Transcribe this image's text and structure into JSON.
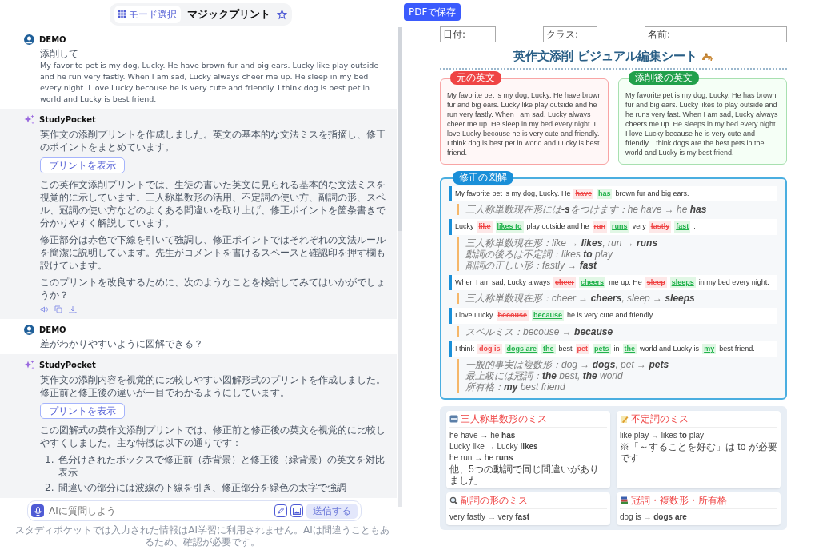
{
  "header": {
    "mode_button": "モード選択",
    "title": "マジックプリント",
    "favorited": false
  },
  "messages": [
    {
      "kind": "user",
      "author": "DEMO",
      "lines": [
        "添削して",
        "My favorite pet is my dog, Lucky. He have brown fur and big ears. Lucky like play outside and he run very fastly. When I am sad, Lucky always cheer me up. He sleep in my bed every night. I love Lucky becouse he is very cute and friendly. I think dog is best pet in world and Lucky is best friend."
      ]
    },
    {
      "kind": "bot",
      "author": "StudyPocket",
      "blocks": [
        {
          "kind": "text",
          "text": "英作文の添削プリントを作成しました。英文の基本的な文法ミスを指摘し、修正のポイントをまとめています。"
        },
        {
          "kind": "button",
          "text": "プリントを表示"
        },
        {
          "kind": "text",
          "text": "この英作文添削プリントでは、生徒の書いた英文に見られる基本的な文法ミスを視覚的に示しています。三人称単数形の活用、不定詞の使い方、副詞の形、スペル、冠詞の使い方などのよくある間違いを取り上げ、修正ポイントを箇条書きで分かりやすく解説しています。"
        },
        {
          "kind": "text",
          "text": "修正部分は赤色で下線を引いて強調し、修正ポイントではそれぞれの文法ルールを簡潔に説明しています。先生がコメントを書けるスペースと確認印を押す欄も設けています。"
        },
        {
          "kind": "text",
          "text": "このプリントを改良するために、次のようなことを検討してみてはいかがでしょうか？"
        },
        {
          "kind": "actions"
        }
      ]
    },
    {
      "kind": "user",
      "author": "DEMO",
      "lines": [
        "差がわかりやすいように図解できる？"
      ]
    },
    {
      "kind": "bot",
      "author": "StudyPocket",
      "blocks": [
        {
          "kind": "text",
          "text": "英作文の添削内容を視覚的に比較しやすい図解形式のプリントを作成しました。修正前と修正後の違いが一目でわかるようにしています。"
        },
        {
          "kind": "button",
          "text": "プリントを表示"
        },
        {
          "kind": "text",
          "text": "この図解式の英作文添削プリントでは、修正前と修正後の英文を視覚的に比較しやすくしました。主な特徴は以下の通りです："
        },
        {
          "kind": "list",
          "items": [
            {
              "number": "1.",
              "text": "色分けされたボックスで修正前（赤背景）と修正後（緑背景）の英文を対比表示"
            },
            {
              "number": "2.",
              "text": "間違いの部分には波線の下線を引き、修正部分を緑色の太字で強調"
            }
          ]
        }
      ]
    }
  ],
  "composer": {
    "placeholder": "AIに質問しよう",
    "send": "送信する",
    "send_disabled": true
  },
  "disclaimer": "スタディポケットでは入力された情報はAI学習に利用されません。AIは間違うこともあるため、確認が必要です。",
  "print": {
    "save_button": "PDFで保存",
    "fields": [
      "日付:",
      "クラス:",
      "名前:"
    ],
    "title": "英作文添削 ビジュアル編集シート",
    "original": {
      "label": "元の英文",
      "text": "My favorite pet is my dog, Lucky. He have brown fur and big ears. Lucky like play outside and he run very fastly. When I am sad, Lucky always cheer me up. He sleep in my bed every night. I love Lucky becouse he is very cute and friendly. I think dog is best pet in world and Lucky is best friend."
    },
    "revised": {
      "label": "添削後の英文",
      "text": "My favorite pet is my dog, Lucky. He has brown fur and big ears. Lucky likes to play outside and he runs very fast. When I am sad, Lucky always cheers me up. He sleeps in my bed every night. I love Lucky because he is very cute and friendly. I think dogs are the best pets in the world and Lucky is my best friend."
    },
    "corrections": {
      "label": "修正の図解",
      "items": [
        {
          "segments": [
            {
              "kind": "text",
              "text": "My favorite pet is my dog, Lucky. He"
            },
            {
              "kind": "wrong",
              "text": "have"
            },
            {
              "kind": "right",
              "text": "has"
            },
            {
              "kind": "text",
              "text": "brown fur and big ears."
            }
          ],
          "notes": [
            "三人称単数現在形には**-s**をつけます：he have → he **has**"
          ]
        },
        {
          "segments": [
            {
              "kind": "text",
              "text": "Lucky"
            },
            {
              "kind": "wrong",
              "text": "like"
            },
            {
              "kind": "right",
              "text": "likes to"
            },
            {
              "kind": "text",
              "text": "play outside and he"
            },
            {
              "kind": "wrong",
              "text": "run"
            },
            {
              "kind": "right",
              "text": "runs"
            },
            {
              "kind": "text",
              "text": "very"
            },
            {
              "kind": "wrong",
              "text": "fastly"
            },
            {
              "kind": "right",
              "text": "fast"
            },
            {
              "kind": "text",
              "text": "."
            }
          ],
          "notes": [
            "三人称単数現在形：like → **likes**, run → **runs**",
            "動詞の後ろは不定詞：likes **to** play",
            "副詞の正しい形：fastly → **fast**"
          ]
        },
        {
          "segments": [
            {
              "kind": "text",
              "text": "When I am sad, Lucky always"
            },
            {
              "kind": "wrong",
              "text": "cheer"
            },
            {
              "kind": "right",
              "text": "cheers"
            },
            {
              "kind": "text",
              "text": "me up. He"
            },
            {
              "kind": "wrong",
              "text": "sleep"
            },
            {
              "kind": "right",
              "text": "sleeps"
            },
            {
              "kind": "text",
              "text": "in my bed every night."
            }
          ],
          "notes": [
            "三人称単数現在形：cheer → **cheers**, sleep → **sleeps**"
          ]
        },
        {
          "segments": [
            {
              "kind": "text",
              "text": "I love Lucky"
            },
            {
              "kind": "wrong",
              "text": "becouse"
            },
            {
              "kind": "right",
              "text": "because"
            },
            {
              "kind": "text",
              "text": "he is very cute and friendly."
            }
          ],
          "notes": [
            "スペルミス：becouse → **because**"
          ]
        },
        {
          "segments": [
            {
              "kind": "text",
              "text": "I think"
            },
            {
              "kind": "wrong",
              "text": "dog is"
            },
            {
              "kind": "right",
              "text": "dogs are"
            },
            {
              "kind": "right",
              "text": "the"
            },
            {
              "kind": "text",
              "text": "best"
            },
            {
              "kind": "wrong",
              "text": "pet"
            },
            {
              "kind": "right",
              "text": "pets"
            },
            {
              "kind": "text",
              "text": "in"
            },
            {
              "kind": "right",
              "text": "the"
            },
            {
              "kind": "text",
              "text": "world and Lucky is"
            },
            {
              "kind": "right",
              "text": "my"
            },
            {
              "kind": "text",
              "text": "best friend."
            }
          ],
          "notes": [
            "一般的事実は複数形：dog → **dogs**, pet → **pets**",
            "最上級には冠詞：**the** best, **the** world",
            "所有格：**my** best friend"
          ]
        }
      ]
    },
    "summary_cards": [
      {
        "title": "三人称単数形のミス",
        "lines": [
          "he have → he **has**",
          "Lucky like → Lucky **likes**",
          "he run → he **runs**",
          "他、5つの動詞で同じ間違いがありました"
        ]
      },
      {
        "title": "不定詞のミス",
        "lines": [
          "like play → likes **to** play",
          "※「～することを好む」は to が必要です"
        ]
      },
      {
        "title": "副詞の形のミス",
        "lines": [
          "very fastly → very **fast**"
        ]
      },
      {
        "title": "冠詞・複数形・所有格",
        "lines": [
          "dog is → **dogs are**"
        ]
      }
    ]
  }
}
